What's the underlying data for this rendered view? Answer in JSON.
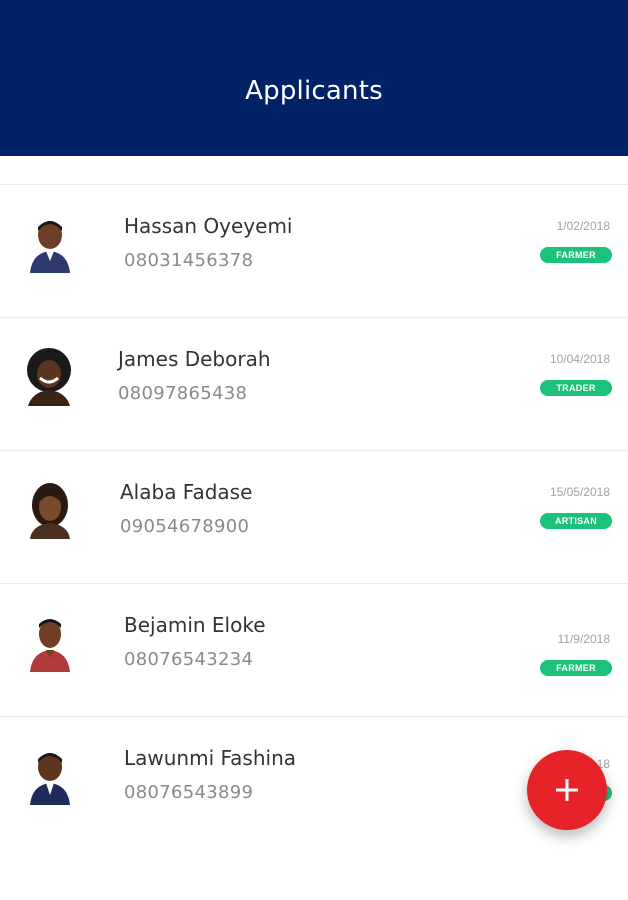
{
  "appbar": {
    "title": "Applicants"
  },
  "applicants": [
    {
      "name": "Hassan Oyeyemi",
      "phone": "08031456378",
      "date": "1/02/2018",
      "tag": "FARMER"
    },
    {
      "name": "James Deborah",
      "phone": "08097865438",
      "date": "10/04/2018",
      "tag": "TRADER"
    },
    {
      "name": "Alaba Fadase",
      "phone": "09054678900",
      "date": "15/05/2018",
      "tag": "ARTISAN"
    },
    {
      "name": "Bejamin Eloke",
      "phone": "08076543234",
      "date": "11/9/2018",
      "tag": "FARMER"
    },
    {
      "name": "Lawunmi Fashina",
      "phone": "08076543899",
      "date": "18",
      "tag": ""
    }
  ],
  "fab": {
    "icon": "plus-icon"
  },
  "colors": {
    "appbar": "#012266",
    "badge": "#1cc27a",
    "fab": "#e52329"
  }
}
